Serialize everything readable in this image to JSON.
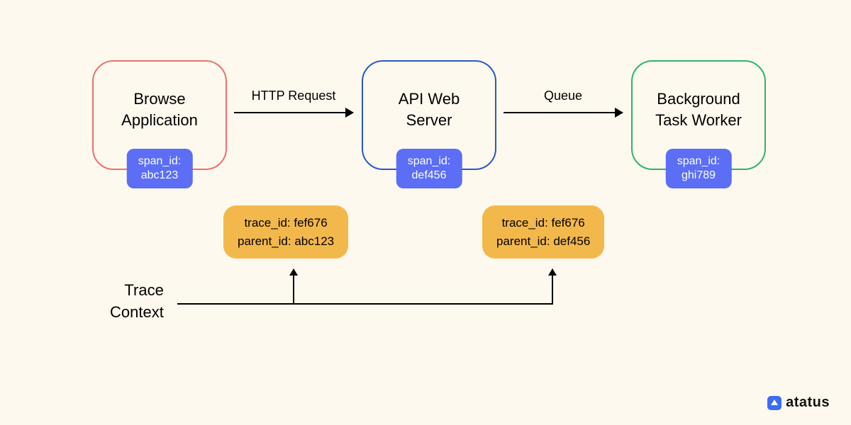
{
  "nodes": {
    "browse": {
      "label": "Browse\nApplication",
      "span": "span_id:\nabc123",
      "borderColor": "#ef6f6f"
    },
    "api": {
      "label": "API Web\nServer",
      "span": "span_id:\ndef456",
      "borderColor": "#2c57c4"
    },
    "worker": {
      "label": "Background\nTask Worker",
      "span": "span_id:\nghi789",
      "borderColor": "#2fb36b"
    }
  },
  "arrows": {
    "http": "HTTP Request",
    "queue": "Queue"
  },
  "context": {
    "left": "trace_id: fef676\nparent_id: abc123",
    "right": "trace_id: fef676\nparent_id: def456"
  },
  "trace_label": "Trace\nContext",
  "brand": "atatus"
}
